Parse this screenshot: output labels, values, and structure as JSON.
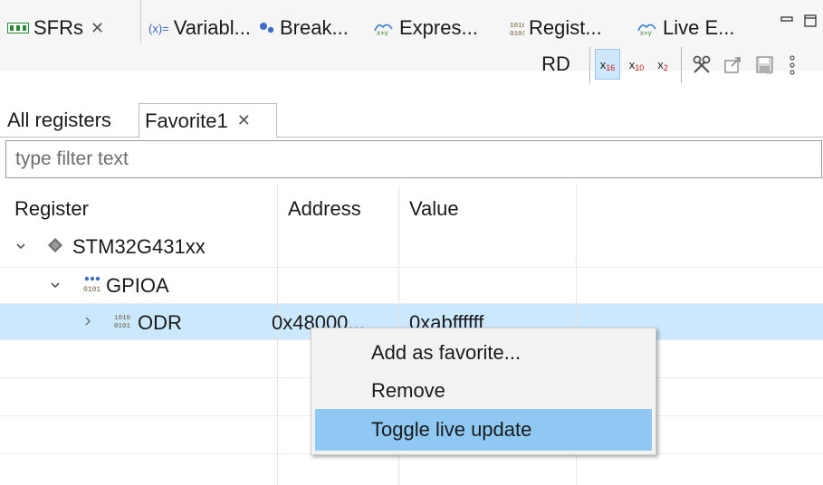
{
  "view_tabs": [
    {
      "label": "SFRs",
      "icon": "memory-board-icon",
      "closable": true,
      "active": true
    },
    {
      "label": "Variabl...",
      "icon": "variables-icon"
    },
    {
      "label": "Break...",
      "icon": "breakpoints-icon"
    },
    {
      "label": "Expres...",
      "icon": "expressions-icon"
    },
    {
      "label": "Regist...",
      "icon": "registers-icon"
    },
    {
      "label": "Live E...",
      "icon": "live-expressions-icon"
    }
  ],
  "view_tab_icon_text": {
    "variables": "(x)="
  },
  "toolbar": {
    "rd_label": "RD",
    "hex_sub": "16",
    "dec_sub": "10",
    "bin_sub": "2",
    "x_glyph": "x"
  },
  "inner_tabs": [
    {
      "label": "All registers"
    },
    {
      "label": "Favorite1",
      "closable": true,
      "active": true
    }
  ],
  "filter": {
    "placeholder": "type filter text",
    "value": ""
  },
  "table": {
    "columns": [
      "Register",
      "Address",
      "Value"
    ],
    "rows": [
      {
        "label": "STM32G431xx",
        "level": 0,
        "expanded": true,
        "icon": "chip-icon",
        "address": "",
        "value": ""
      },
      {
        "label": "GPIOA",
        "level": 1,
        "expanded": true,
        "icon": "peripheral-icon",
        "address": "",
        "value": ""
      },
      {
        "label": "ODR",
        "level": 2,
        "expanded": false,
        "icon": "register-icon",
        "address": "0x48000...",
        "value": "0xabffffff",
        "selected": true
      }
    ]
  },
  "context_menu": {
    "items": [
      {
        "label": "Add as favorite..."
      },
      {
        "label": "Remove"
      },
      {
        "label": "Toggle live update",
        "highlighted": true
      }
    ]
  },
  "colors": {
    "selection": "#cce8ff",
    "menu_highlight": "#8fc8f2",
    "active_toggle": "#cfe7fb"
  }
}
